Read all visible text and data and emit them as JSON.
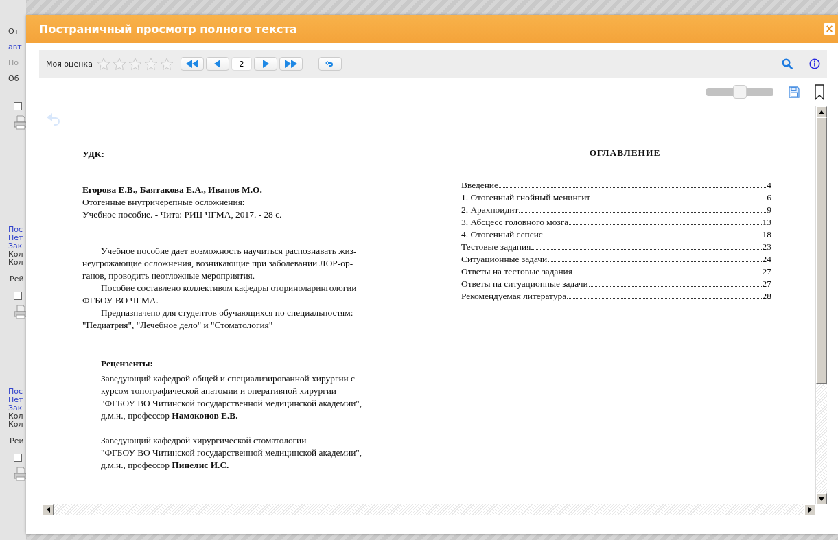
{
  "background_page": {
    "top": [
      {
        "text": "От",
        "kind": "text"
      },
      {
        "text": "авт",
        "kind": "link"
      },
      {
        "text": "По",
        "kind": "muted"
      },
      {
        "text": "Об",
        "kind": "text"
      }
    ],
    "records": [
      {
        "lines": [
          {
            "text": "Пос",
            "kind": "link"
          },
          {
            "text": "Нет",
            "kind": "link"
          },
          {
            "text": "Зак",
            "kind": "link"
          },
          {
            "text": "Кол",
            "kind": "text"
          },
          {
            "text": "Кол",
            "kind": "text"
          }
        ],
        "rating": "Рей",
        "checked": false
      },
      {
        "lines": [
          {
            "text": "Пос",
            "kind": "link"
          },
          {
            "text": "Нет",
            "kind": "link"
          },
          {
            "text": "Зак",
            "kind": "link"
          },
          {
            "text": "Кол",
            "kind": "text"
          },
          {
            "text": "Кол",
            "kind": "text"
          }
        ],
        "rating": "Рей",
        "checked": false
      }
    ],
    "checked": false
  },
  "dialog": {
    "title": "Постраничный просмотр полного текста",
    "close": "×"
  },
  "toolbar": {
    "rating_label": "Моя оценка",
    "rating": {
      "stars": 0
    },
    "page": "2"
  },
  "zoom_slider": {
    "level": 0.5
  },
  "left_page": {
    "udc": "УДК:",
    "authors": "Егорова Е.В., Баятакова Е.А., Иванов М.О.",
    "title": "Отогенные внутричерепные осложнения:",
    "imprint": "Учебное пособие. - Чита: РИЦ ЧГМА, 2017. - 28 с.",
    "paragraphs": [
      "Учебное пособие дает возможность научиться распознавать жиз-\nнеугрожающие осложнения, возникающие при заболевании ЛОР-ор-\nганов, проводить неотложные мероприятия.",
      "Пособие составлено коллективом кафедры оториноларингологии\nФГБОУ ВО ЧГМА.",
      "Предназначено для студентов обучающихся по специальностям:\n\"Педиатрия\", \"Лечебное дело\" и \"Стоматология\""
    ],
    "reviewers_heading": "Рецензенты:",
    "reviewers": [
      "Заведующий кафедрой общей и специализированной хирургии с\nкурсом топографической анатомии и оперативной хирургии\n\"ФГБОУ ВО Читинской государственной медицинской академии\",\nд.м.н., профессор **Намоконов Е.В.**",
      "Заведующий кафедрой хирургической стоматологии\n\"ФГБОУ ВО Читинской государственной медицинской академии\",\nд.м.н., профессор **Пинелис И.С.**"
    ]
  },
  "right_page": {
    "heading": "ОГЛАВЛЕНИЕ",
    "toc": [
      {
        "title": "Введение",
        "page": "4"
      },
      {
        "title": "1. Отогенный гнойный менингит",
        "page": "6"
      },
      {
        "title": "2. Арахноидит",
        "page": "9"
      },
      {
        "title": "3. Абсцесс головного мозга",
        "page": "13"
      },
      {
        "title": "4. Отогенный сепсис",
        "page": "18"
      },
      {
        "title": "Тестовые задания",
        "page": "23"
      },
      {
        "title": "Ситуационные задачи",
        "page": "24"
      },
      {
        "title": "Ответы на тестовые задания",
        "page": "27"
      },
      {
        "title": "Ответы на ситуационные задачи",
        "page": "27"
      },
      {
        "title": "Рекомендуемая литература",
        "page": "28"
      }
    ]
  }
}
